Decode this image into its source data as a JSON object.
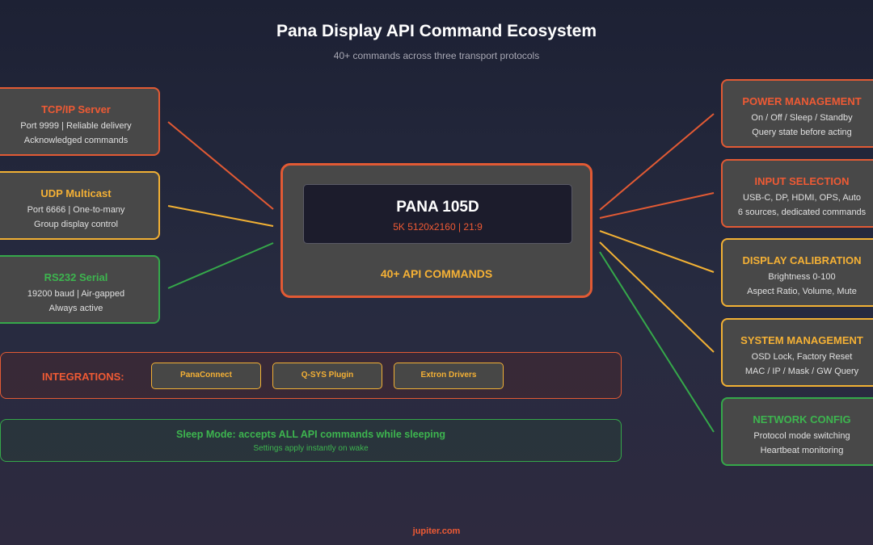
{
  "title": "Pana Display API Command Ecosystem",
  "subtitle": "40+ commands across three transport protocols",
  "colors": {
    "red": "#e25a34",
    "amber": "#f2b134",
    "green": "#35a84a"
  },
  "transports": [
    {
      "name": "TCP/IP Server",
      "lines": [
        "Port 9999 | Reliable delivery",
        "Acknowledged commands"
      ],
      "color": "red"
    },
    {
      "name": "UDP Multicast",
      "lines": [
        "Port 6666 | One-to-many",
        "Group display control"
      ],
      "color": "amber"
    },
    {
      "name": "RS232 Serial",
      "lines": [
        "19200 baud | Air-gapped",
        "Always active"
      ],
      "color": "green"
    }
  ],
  "display": {
    "model": "PANA 105D",
    "spec": "5K 5120x2160 | 21:9",
    "commands": "40+ API COMMANDS"
  },
  "categories": [
    {
      "name": "POWER MANAGEMENT",
      "lines": [
        "On / Off / Sleep / Standby",
        "Query state before acting"
      ],
      "color": "red"
    },
    {
      "name": "INPUT SELECTION",
      "lines": [
        "USB-C, DP, HDMI, OPS, Auto",
        "6 sources, dedicated commands"
      ],
      "color": "red"
    },
    {
      "name": "DISPLAY CALIBRATION",
      "lines": [
        "Brightness 0-100",
        "Aspect Ratio, Volume, Mute"
      ],
      "color": "amber"
    },
    {
      "name": "SYSTEM MANAGEMENT",
      "lines": [
        "OSD Lock, Factory Reset",
        "MAC / IP / Mask / GW Query"
      ],
      "color": "amber"
    },
    {
      "name": "NETWORK CONFIG",
      "lines": [
        "Protocol mode switching",
        "Heartbeat monitoring"
      ],
      "color": "green"
    }
  ],
  "integrations": {
    "label": "INTEGRATIONS:",
    "items": [
      "PanaConnect",
      "Q-SYS Plugin",
      "Extron Drivers"
    ]
  },
  "sleep": {
    "icon": "moon-icon",
    "glyph": "",
    "main": "Sleep Mode: accepts ALL API commands while sleeping",
    "sub": "Settings apply instantly on wake"
  },
  "footer": "jupiter.com"
}
